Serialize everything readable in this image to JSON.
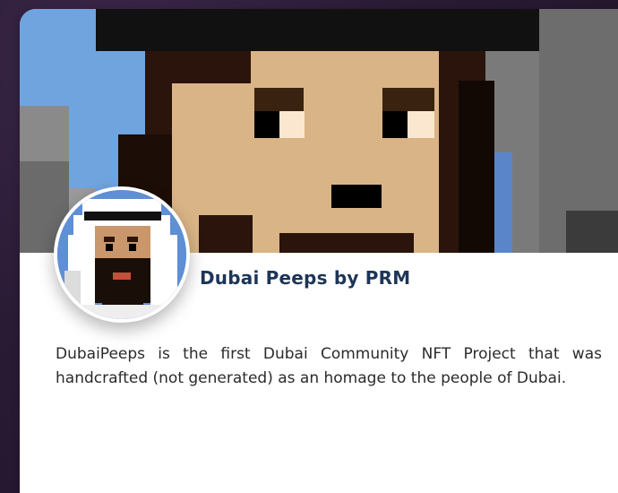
{
  "card": {
    "title": "Dubai Peeps by PRM",
    "description": "DubaiPeeps is the first Dubai Community NFT Project that was handcrafted (not generated) as an homage to the people of Dubai."
  },
  "icons": {
    "banner": "pixel-art-character-banner",
    "avatar": "pixel-art-emirati-avatar"
  },
  "colors": {
    "page_background": "#2a1b35",
    "title": "#1d3557",
    "description": "#2b2b2b",
    "banner_sky": "#6fa4df"
  }
}
